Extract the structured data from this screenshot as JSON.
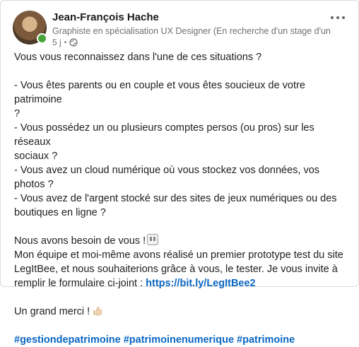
{
  "post": {
    "author_name": "Jean-François Hache",
    "author_headline": "Graphiste en spécialisation UX Designer (En recherche d'un stage d'un ...",
    "timestamp": "5 j",
    "meta_separator": "•",
    "visibility_icon": "globe-icon",
    "presence_color": "#48a33a",
    "lines": {
      "intro": "Vous vous reconnaissez dans l'une de ces situations ?",
      "q1": "- Vous êtes parents ou en couple et vous êtes soucieux de votre patrimoine\n?",
      "q2": "- Vous possédez un ou plusieurs comptes persos (ou pros) sur les réseaux\nsociaux ?",
      "q3": "- Vous avez un cloud numérique où vous stockez vos données, vos photos ?",
      "q4": "- Vous avez de l'argent stocké sur des sites de jeux numériques ou des\nboutiques en ligne ?",
      "need": "Nous avons besoin de vous !",
      "team": "Mon équipe et moi-même avons réalisé un premier prototype test du site\nLegItBee, et nous souhaiterions grâce à vous, le tester. Je vous invite à\nremplir le formulaire ci-joint : ",
      "link": "https://bit.ly/LegItBee2",
      "thanks": "Un grand merci !"
    },
    "hashtags": [
      "#gestiondepatrimoine",
      "#patrimoinenumerique",
      "#patrimoine"
    ],
    "link_color": "#0a66c2"
  }
}
